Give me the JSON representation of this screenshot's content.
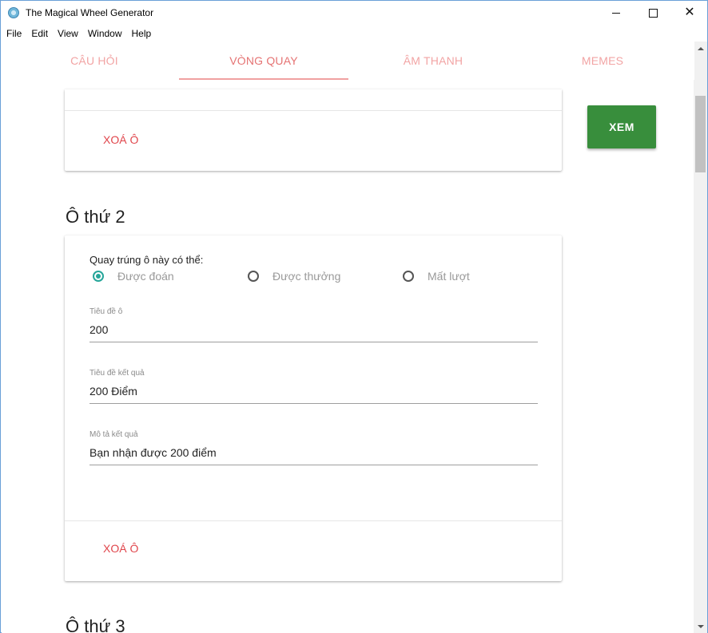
{
  "window": {
    "title": "The Magical Wheel Generator",
    "minimize_icon": "minimize-icon",
    "maximize_icon": "maximize-icon",
    "close_icon": "close-icon",
    "close_glyph": "✕"
  },
  "menu": [
    "File",
    "Edit",
    "View",
    "Window",
    "Help"
  ],
  "tabs": [
    {
      "label": "CÂU HỎI",
      "active": false
    },
    {
      "label": "VÒNG QUAY",
      "active": true
    },
    {
      "label": "ÂM THANH",
      "active": false
    },
    {
      "label": "MEMES",
      "active": false
    }
  ],
  "colors": {
    "accent": "#e57373",
    "tab_inactive": "#f2a4a4",
    "radio_checked": "#26a69a",
    "primary_button": "#388e3c",
    "delete_text": "#e0454b"
  },
  "top_card": {
    "delete_label": "XOÁ Ô"
  },
  "side": {
    "view_label": "XEM"
  },
  "slot2": {
    "title": "Ô thứ 2",
    "question": "Quay trúng ô này có thể:",
    "options": [
      {
        "label": "Được đoán",
        "checked": true
      },
      {
        "label": "Được thưởng",
        "checked": false
      },
      {
        "label": "Mất lượt",
        "checked": false
      }
    ],
    "fields": [
      {
        "label": "Tiêu đề ô",
        "value": "200"
      },
      {
        "label": "Tiêu đề kết quả",
        "value": "200 Điểm"
      },
      {
        "label": "Mô tả kết quả",
        "value": "Bạn nhận được 200 điểm"
      }
    ],
    "delete_label": "XOÁ Ô"
  },
  "slot3": {
    "title": "Ô thứ 3"
  }
}
